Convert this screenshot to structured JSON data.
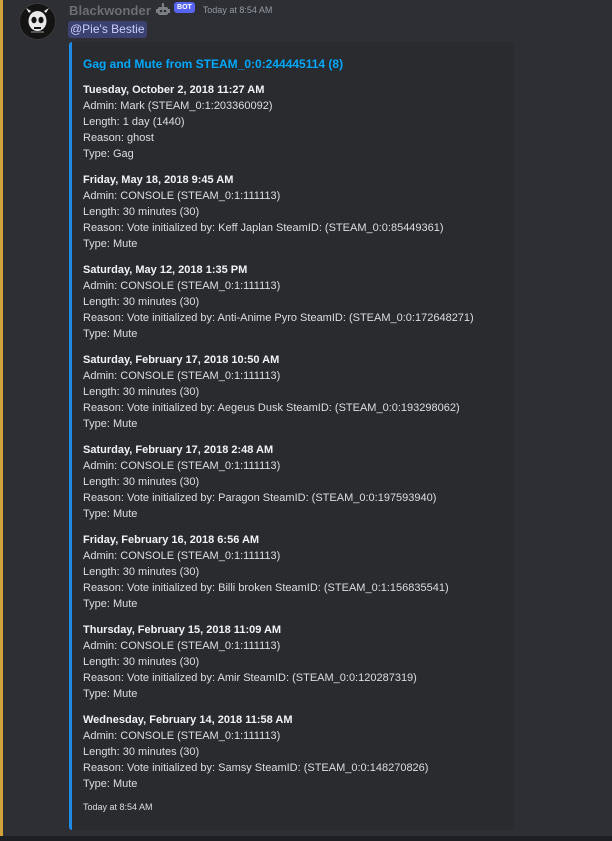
{
  "message": {
    "author": "Blackwonder",
    "author_icon": "robot-icon",
    "bot_tag": "BOT",
    "timestamp": "Today at 8:54 AM",
    "mention": "@Pie's Bestie",
    "avatar": "skull-avatar"
  },
  "embed": {
    "title": "Gag and Mute from STEAM_0:0:244445114 (8)",
    "accent_color": "#1e8be5",
    "footer": "Today at 8:54 AM",
    "fields": [
      {
        "name": "Tuesday, October 2, 2018 11:27 AM",
        "lines": [
          "Admin: Mark (STEAM_0:1:203360092)",
          "Length: 1 day (1440)",
          "Reason: ghost",
          "Type: Gag"
        ]
      },
      {
        "name": "Friday, May 18, 2018 9:45 AM",
        "lines": [
          "Admin: CONSOLE (STEAM_0:1:111113)",
          "Length: 30 minutes (30)",
          "Reason: Vote initialized by: Keff Japlan SteamID: (STEAM_0:0:85449361)",
          "Type: Mute"
        ]
      },
      {
        "name": "Saturday, May 12, 2018 1:35 PM",
        "lines": [
          "Admin: CONSOLE (STEAM_0:1:111113)",
          "Length: 30 minutes (30)",
          "Reason: Vote initialized by: Anti-Anime Pyro SteamID: (STEAM_0:0:172648271)",
          "Type: Mute"
        ]
      },
      {
        "name": "Saturday, February 17, 2018 10:50 AM",
        "lines": [
          "Admin: CONSOLE (STEAM_0:1:111113)",
          "Length: 30 minutes (30)",
          "Reason: Vote initialized by: Aegeus Dusk SteamID: (STEAM_0:0:193298062)",
          "Type: Mute"
        ]
      },
      {
        "name": "Saturday, February 17, 2018 2:48 AM",
        "lines": [
          "Admin: CONSOLE (STEAM_0:1:111113)",
          "Length: 30 minutes (30)",
          "Reason: Vote initialized by: Paragon SteamID: (STEAM_0:0:197593940)",
          "Type: Mute"
        ]
      },
      {
        "name": "Friday, February 16, 2018 6:56 AM",
        "lines": [
          "Admin: CONSOLE (STEAM_0:1:111113)",
          "Length: 30 minutes (30)",
          "Reason: Vote initialized by: Billi broken SteamID: (STEAM_0:1:156835541)",
          "Type: Mute"
        ]
      },
      {
        "name": "Thursday, February 15, 2018 11:09 AM",
        "lines": [
          "Admin: CONSOLE (STEAM_0:1:111113)",
          "Length: 30 minutes (30)",
          "Reason: Vote initialized by: Amir SteamID: (STEAM_0:0:120287319)",
          "Type: Mute"
        ]
      },
      {
        "name": "Wednesday, February 14, 2018 11:58 AM",
        "lines": [
          "Admin: CONSOLE (STEAM_0:1:111113)",
          "Length: 30 minutes (30)",
          "Reason: Vote initialized by: Samsy SteamID: (STEAM_0:0:148270826)",
          "Type: Mute"
        ]
      }
    ]
  }
}
